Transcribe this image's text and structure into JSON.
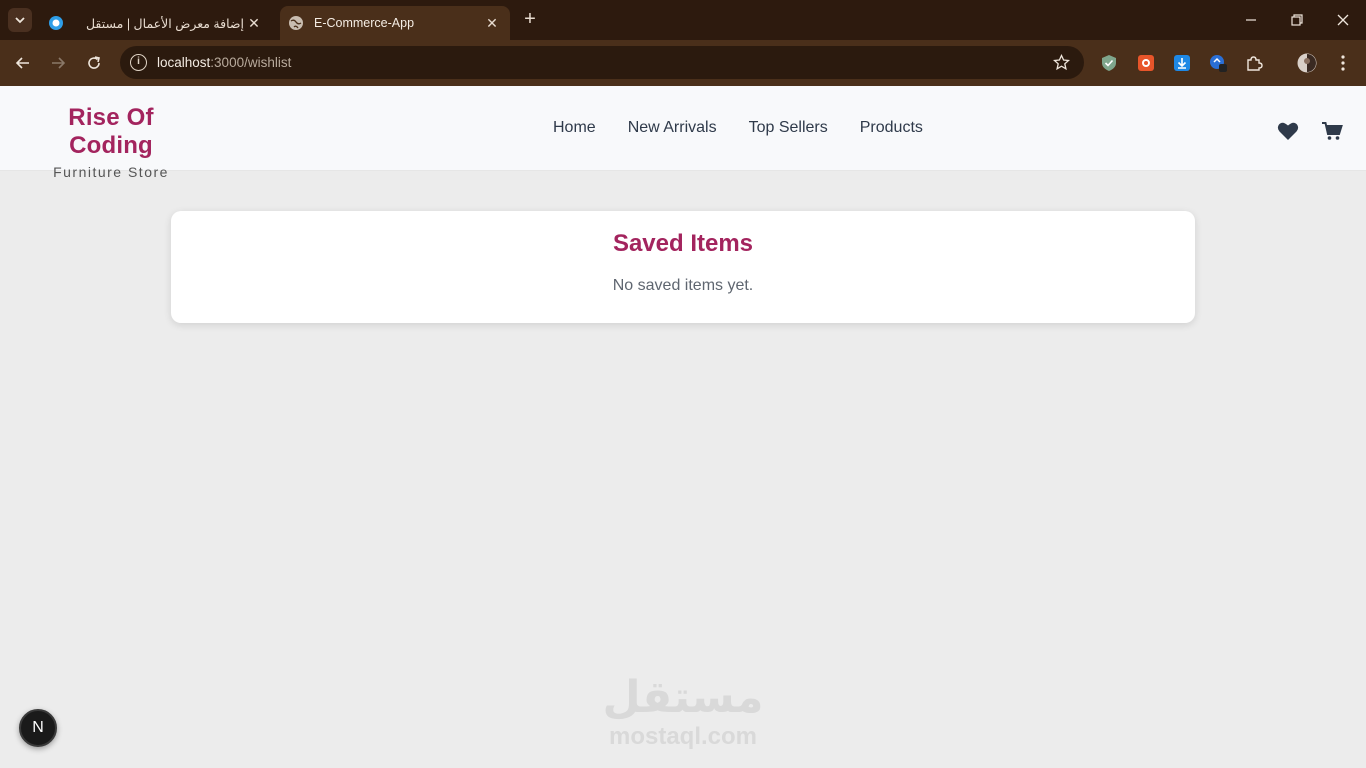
{
  "browser": {
    "tabs": [
      {
        "title": "إضافة معرض الأعمال | مستقل",
        "active": false,
        "favicon": "mostaql-circle-icon"
      },
      {
        "title": "E-Commerce-App",
        "active": true,
        "favicon": "globe-icon"
      }
    ],
    "new_tab": "+",
    "url_host": "localhost",
    "url_rest": ":3000/wishlist"
  },
  "header": {
    "brand": "Rise Of Coding",
    "tagline": "Furniture Store",
    "nav": [
      "Home",
      "New Arrivals",
      "Top Sellers",
      "Products"
    ]
  },
  "wishlist": {
    "title": "Saved Items",
    "empty_message": "No saved items yet."
  },
  "watermark": {
    "arabic": "مستقل",
    "latin": "mostaql.com"
  },
  "dev_badge": "N",
  "colors": {
    "brand": "#a3245e",
    "chrome_dark": "#2d1a0e",
    "chrome_toolbar": "#4a2f1a",
    "page_bg": "#ececec"
  }
}
